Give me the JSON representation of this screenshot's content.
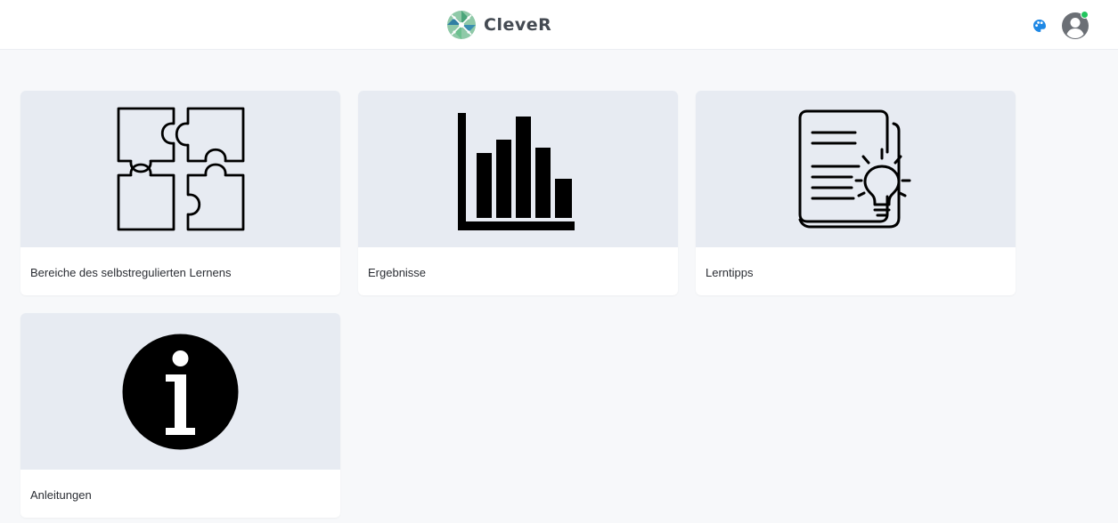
{
  "header": {
    "app_name": "CleveR",
    "logo_icon": "clever-logo-icon",
    "palette_icon": "palette-icon",
    "avatar_icon": "user-avatar-icon",
    "status_color": "#22c55e"
  },
  "cards": [
    {
      "label": "Bereiche des selbstregulierten Lernens",
      "icon": "puzzle-icon"
    },
    {
      "label": "Ergebnisse",
      "icon": "bar-chart-icon"
    },
    {
      "label": "Lerntipps",
      "icon": "document-lightbulb-icon"
    },
    {
      "label": "Anleitungen",
      "icon": "info-icon"
    }
  ]
}
